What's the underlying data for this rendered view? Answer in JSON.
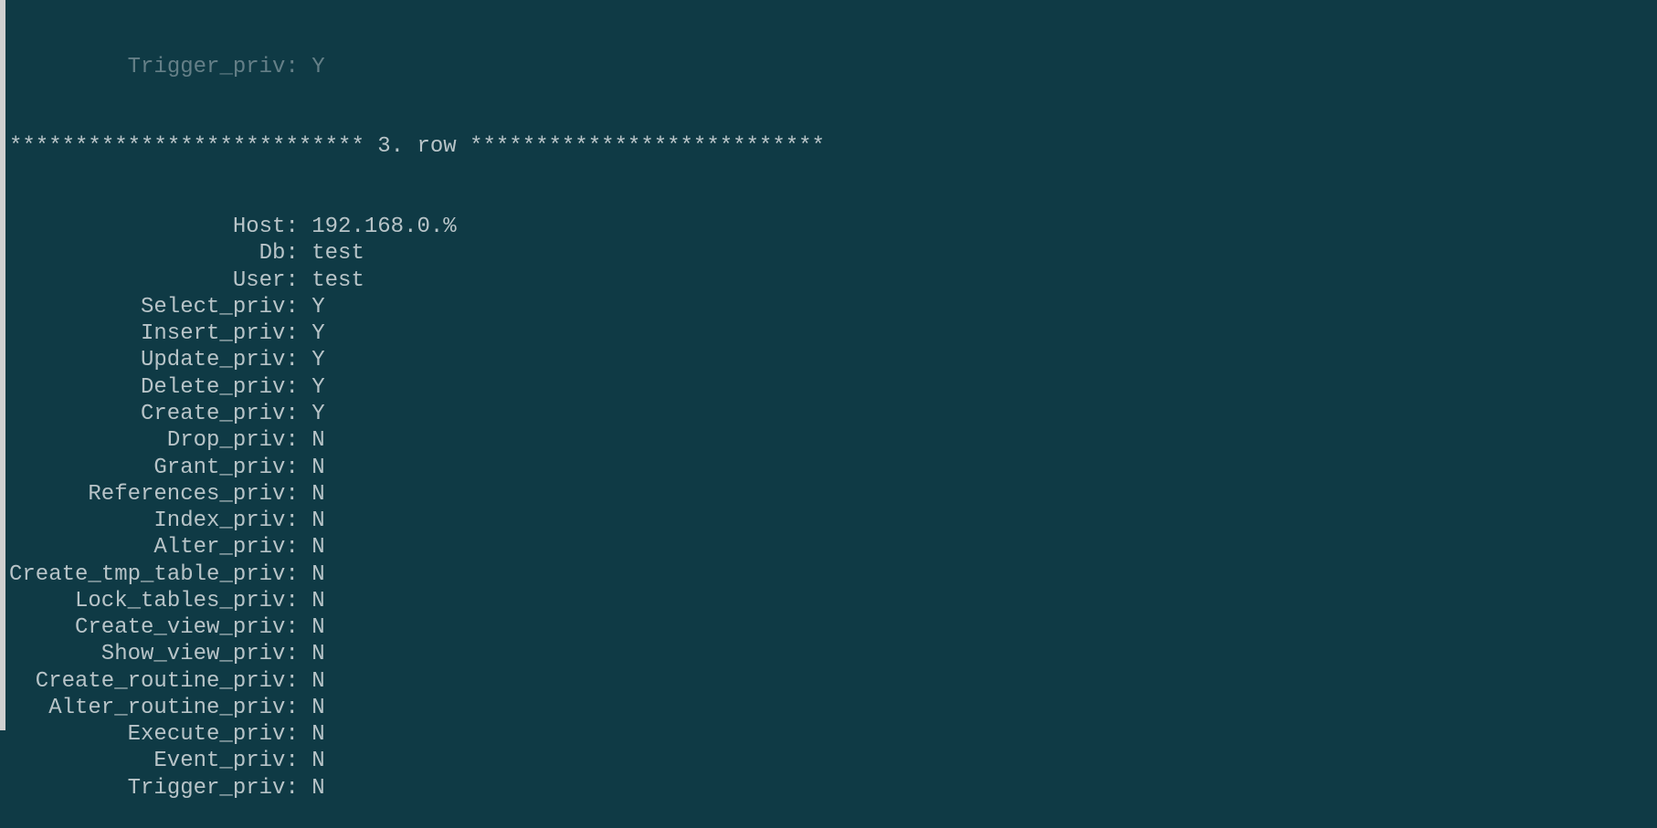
{
  "partial_line": "         Trigger_priv: Y",
  "separator": "*************************** 3. row ***************************",
  "fields": [
    {
      "label": "Host",
      "value": "192.168.0.%"
    },
    {
      "label": "Db",
      "value": "test"
    },
    {
      "label": "User",
      "value": "test"
    },
    {
      "label": "Select_priv",
      "value": "Y"
    },
    {
      "label": "Insert_priv",
      "value": "Y"
    },
    {
      "label": "Update_priv",
      "value": "Y"
    },
    {
      "label": "Delete_priv",
      "value": "Y"
    },
    {
      "label": "Create_priv",
      "value": "Y"
    },
    {
      "label": "Drop_priv",
      "value": "N"
    },
    {
      "label": "Grant_priv",
      "value": "N"
    },
    {
      "label": "References_priv",
      "value": "N"
    },
    {
      "label": "Index_priv",
      "value": "N"
    },
    {
      "label": "Alter_priv",
      "value": "N"
    },
    {
      "label": "Create_tmp_table_priv",
      "value": "N"
    },
    {
      "label": "Lock_tables_priv",
      "value": "N"
    },
    {
      "label": "Create_view_priv",
      "value": "N"
    },
    {
      "label": "Show_view_priv",
      "value": "N"
    },
    {
      "label": "Create_routine_priv",
      "value": "N"
    },
    {
      "label": "Alter_routine_priv",
      "value": "N"
    },
    {
      "label": "Execute_priv",
      "value": "N"
    },
    {
      "label": "Event_priv",
      "value": "N"
    },
    {
      "label": "Trigger_priv",
      "value": "N"
    }
  ]
}
